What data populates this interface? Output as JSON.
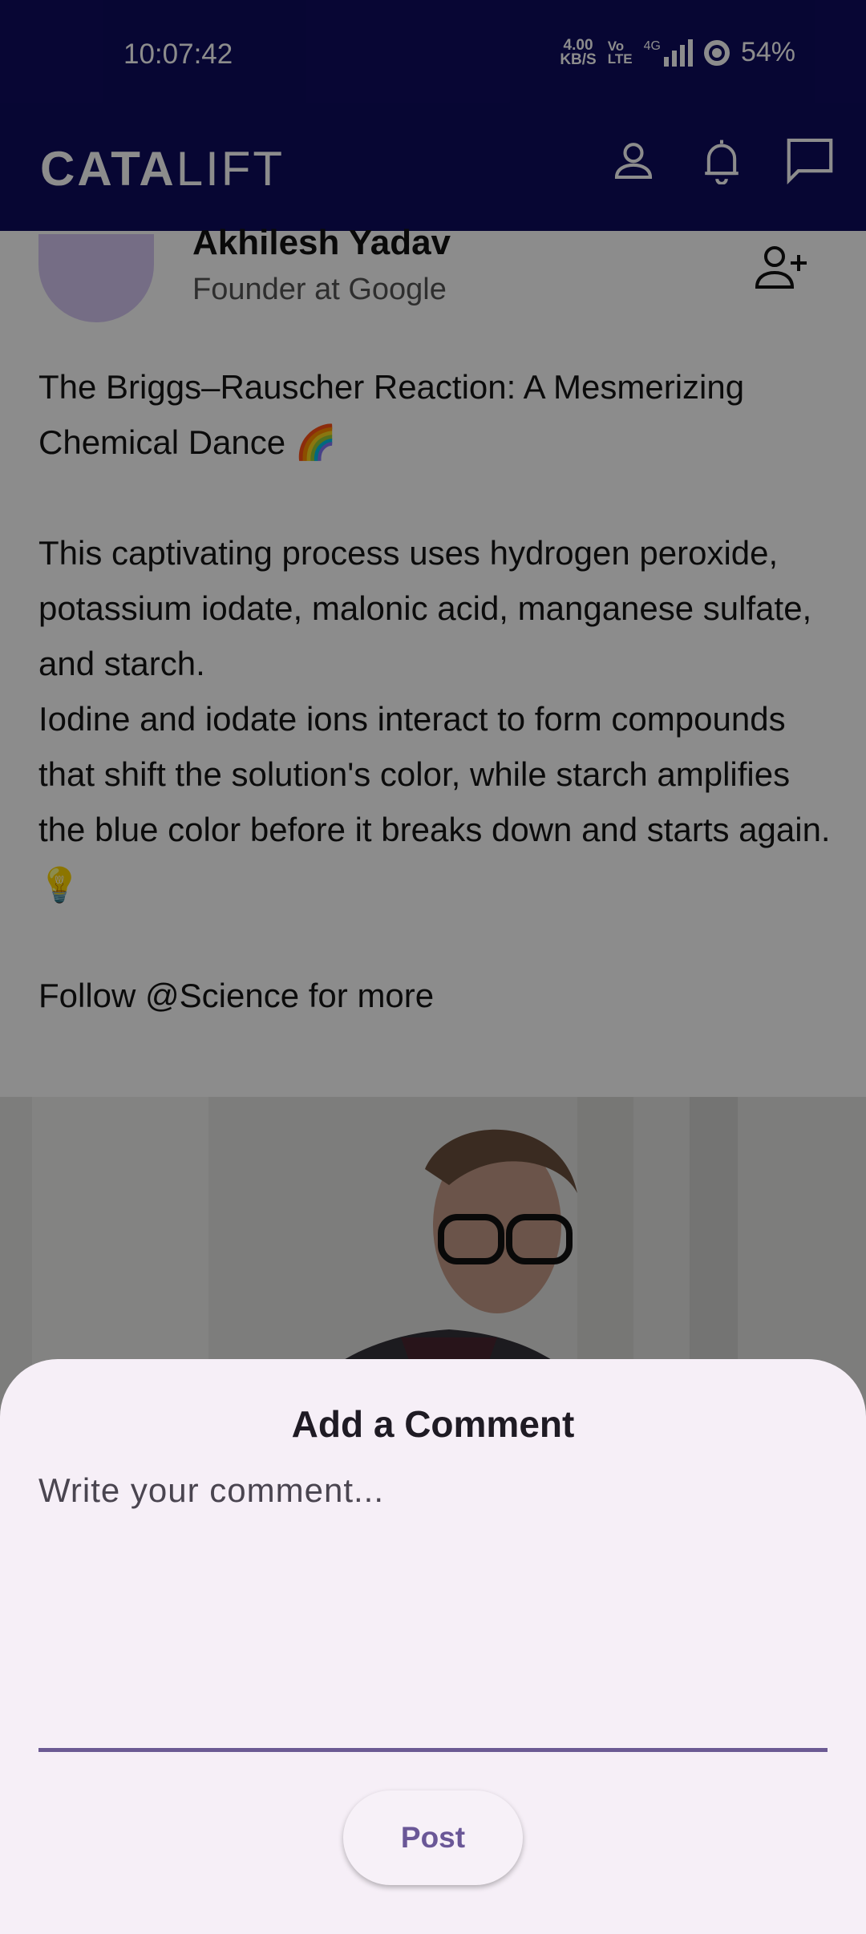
{
  "status_bar": {
    "time": "10:07:42",
    "net_speed_value": "4.00",
    "net_speed_unit": "KB/S",
    "volte_top": "Vo",
    "volte_bottom": "LTE",
    "network": "4G",
    "battery": "54%"
  },
  "app_bar": {
    "brand_bold": "CATA",
    "brand_light": "LIFT",
    "icons": [
      "profile-icon",
      "bell-icon",
      "chat-icon"
    ]
  },
  "post": {
    "author_name": "Akhilesh Yadav",
    "author_role": "Founder at Google",
    "text": "The Briggs–Rauscher Reaction: A Mesmerizing Chemical Dance 🌈\n\nThis captivating process uses hydrogen peroxide, potassium iodate, malonic acid, manganese sulfate, and starch.\nIodine and iodate ions interact to form compounds that shift the solution's color, while starch amplifies the blue color before it breaks down and starts again. 💡\n\nFollow @Science for more"
  },
  "comment_sheet": {
    "title": "Add a Comment",
    "input_placeholder": "Write your comment...",
    "input_value": "",
    "post_label": "Post"
  },
  "colors": {
    "app_bar": "#0e0b5e",
    "sheet_bg": "#f6eff7",
    "accent": "#6c5a93"
  }
}
